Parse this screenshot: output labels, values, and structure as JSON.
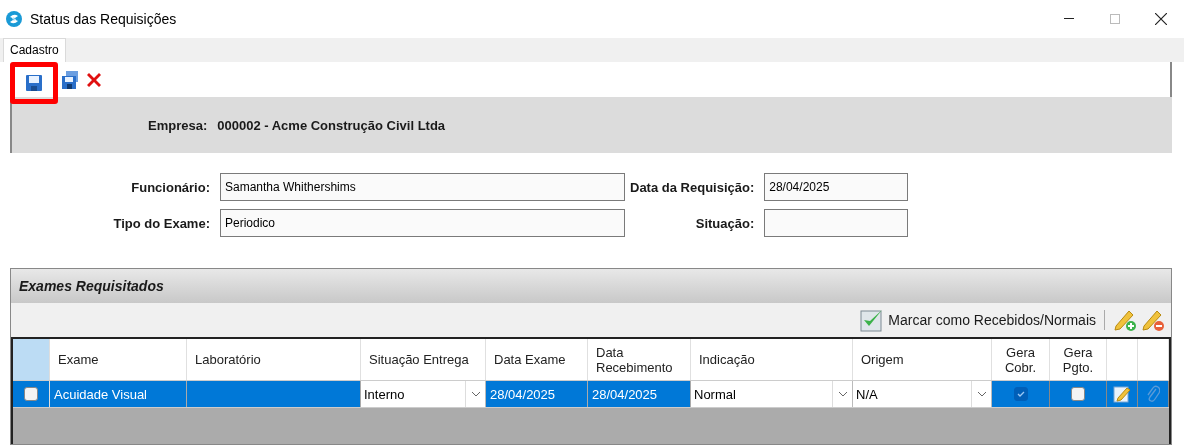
{
  "window": {
    "title": "Status das Requisições"
  },
  "menu_tabs": [
    {
      "label": "Cadastro",
      "selected": true
    }
  ],
  "toolbar": [
    {
      "kind": "save",
      "highlighted": true
    },
    {
      "kind": "save-copy",
      "highlighted": false
    },
    {
      "kind": "delete",
      "highlighted": false
    }
  ],
  "empresa": {
    "label": "Empresa:",
    "value": "000002 - Acme Construção Civil Ltda"
  },
  "form": {
    "left": [
      {
        "label": "Funcionário:",
        "value": "Samantha Whithershims"
      },
      {
        "label": "Tipo do Exame:",
        "value": "Periodico"
      }
    ],
    "right": [
      {
        "label": "Data da Requisição:",
        "value": "28/04/2025"
      },
      {
        "label": "Situação:"
      }
    ]
  },
  "section": {
    "title": "Exames Requisitados",
    "action": "Marcar como Recebidos/Normais"
  },
  "table": {
    "columns": [
      "Exame",
      "Laboratório",
      "Situação Entrega",
      "Data Exame",
      "Data Recebimento",
      "Indicação",
      "Origem",
      "Gera Cobr.",
      "Gera Pgto."
    ],
    "rows": [
      {
        "selected": true,
        "checked": false,
        "exame": "Acuidade Visual",
        "laboratorio": "",
        "situacao_entrega": "Interno",
        "data_exame": "28/04/2025",
        "data_recebimento": "28/04/2025",
        "indicacao": "Normal",
        "origem": "N/A",
        "gera_cobr": true,
        "gera_pgto": false
      }
    ]
  }
}
